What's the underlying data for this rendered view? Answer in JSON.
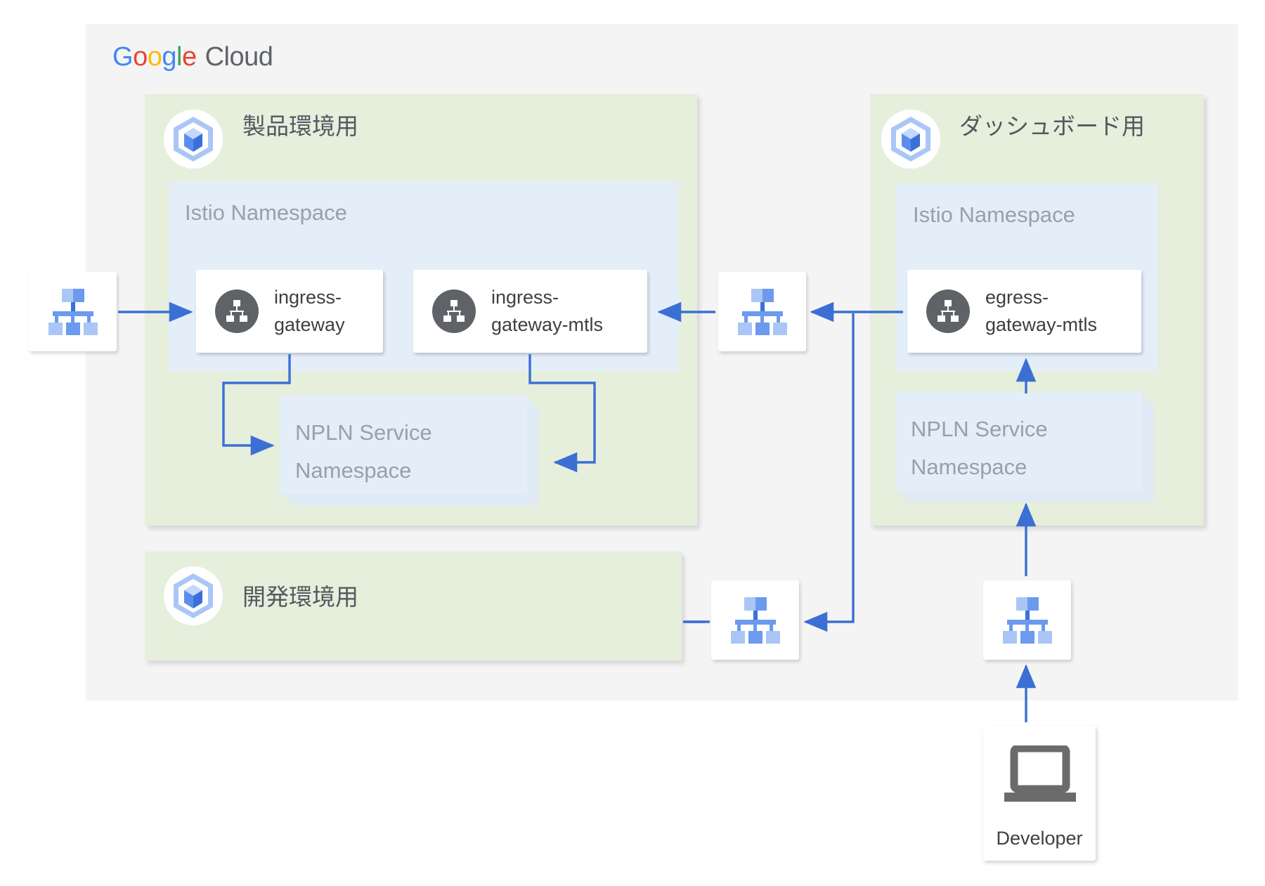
{
  "brand": {
    "g1": "G",
    "o1": "o",
    "o2": "o",
    "g2": "g",
    "l": "l",
    "e": "e",
    "cloud": "Cloud",
    "colors": {
      "blue": "#4285f4",
      "red": "#ea4335",
      "yellow": "#fbbc05",
      "green": "#34a853",
      "gray": "#5f6368"
    }
  },
  "clusters": [
    {
      "id": "prod",
      "title": "製品環境用",
      "icon": "gke-cluster-icon"
    },
    {
      "id": "dashboard",
      "title": "ダッシュボード用",
      "icon": "gke-cluster-icon"
    },
    {
      "id": "dev",
      "title": "開発環境用",
      "icon": "gke-cluster-icon"
    }
  ],
  "namespaces": {
    "istio_prod": "Istio Namespace",
    "istio_dashboard": "Istio Namespace",
    "npln_prod": "NPLN Service\nNamespace",
    "npln_prod_line1": "NPLN Service",
    "npln_prod_line2": "Namespace",
    "npln_dashboard_line1": "NPLN Service",
    "npln_dashboard_line2": "Namespace"
  },
  "gateways": [
    {
      "id": "ingress-gateway",
      "line1": "ingress-",
      "line2": "gateway",
      "icon": "gateway-icon"
    },
    {
      "id": "ingress-gateway-mtls",
      "line1": "ingress-",
      "line2": "gateway-mtls",
      "icon": "gateway-icon"
    },
    {
      "id": "egress-gateway-mtls",
      "line1": "egress-",
      "line2": "gateway-mtls",
      "icon": "gateway-icon"
    }
  ],
  "network_nodes": [
    {
      "id": "net-external-left",
      "icon": "network-load-balancer-icon"
    },
    {
      "id": "net-middle-top",
      "icon": "network-load-balancer-icon"
    },
    {
      "id": "net-middle-bottom",
      "icon": "network-load-balancer-icon"
    },
    {
      "id": "net-developer",
      "icon": "network-load-balancer-icon"
    }
  ],
  "developer": {
    "label": "Developer",
    "icon": "laptop-icon"
  },
  "palette": {
    "canvas": "#f4f4f4",
    "cluster_green": "#e6eedc",
    "namespace_blue": "#e3eef9",
    "arrow_blue": "#3b6fd4",
    "gateway_circle": "#5f6368",
    "text_gray": "#3c4043",
    "muted_gray": "#9aa0a6",
    "net_light": "#aac6f7",
    "net_dark": "#6b9aee"
  }
}
